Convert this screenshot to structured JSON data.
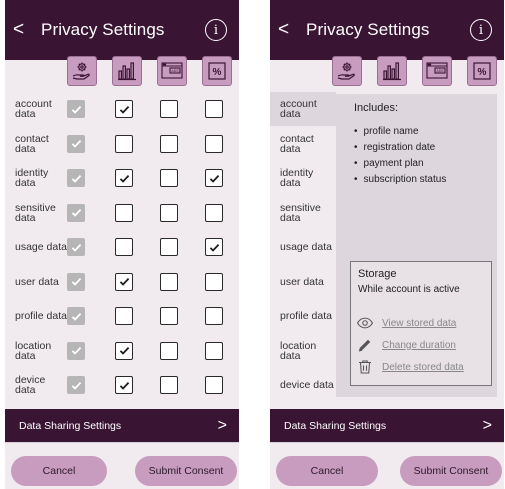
{
  "header": {
    "title": "Privacy Settings",
    "back": "<",
    "info": "i"
  },
  "column_icons": [
    "hand-gear-icon",
    "bar-chart-icon",
    "ads-window-icon",
    "percent-icon"
  ],
  "ads_label": "ADS",
  "percent_label": "%",
  "rows": [
    {
      "label": "account data",
      "checks": [
        true,
        true,
        false,
        false
      ]
    },
    {
      "label": "contact data",
      "checks": [
        true,
        false,
        false,
        false
      ]
    },
    {
      "label": "identity data",
      "checks": [
        true,
        true,
        false,
        true
      ]
    },
    {
      "label": "sensitive data",
      "checks": [
        true,
        false,
        false,
        false
      ]
    },
    {
      "label": "usage data",
      "checks": [
        true,
        false,
        false,
        true
      ]
    },
    {
      "label": "user data",
      "checks": [
        true,
        true,
        false,
        false
      ]
    },
    {
      "label": "profile data",
      "checks": [
        true,
        false,
        false,
        false
      ]
    },
    {
      "label": "location data",
      "checks": [
        true,
        true,
        false,
        false
      ]
    },
    {
      "label": "device data",
      "checks": [
        true,
        true,
        false,
        false
      ]
    }
  ],
  "detail": {
    "includes_title": "Includes:",
    "includes": [
      "profile name",
      "registration date",
      "payment plan",
      "subscription status"
    ],
    "storage_title": "Storage",
    "storage_value": "While account is active",
    "actions": [
      "View stored data",
      "Change duration",
      "Delete stored data"
    ]
  },
  "sharing_bar": {
    "label": "Data Sharing Settings",
    "chevron": ">"
  },
  "buttons": {
    "cancel": "Cancel",
    "submit": "Submit Consent"
  },
  "colors": {
    "header": "#3a1433",
    "accent": "#c89cbf",
    "background": "#f1ebf0",
    "panel": "#ded6dd"
  }
}
